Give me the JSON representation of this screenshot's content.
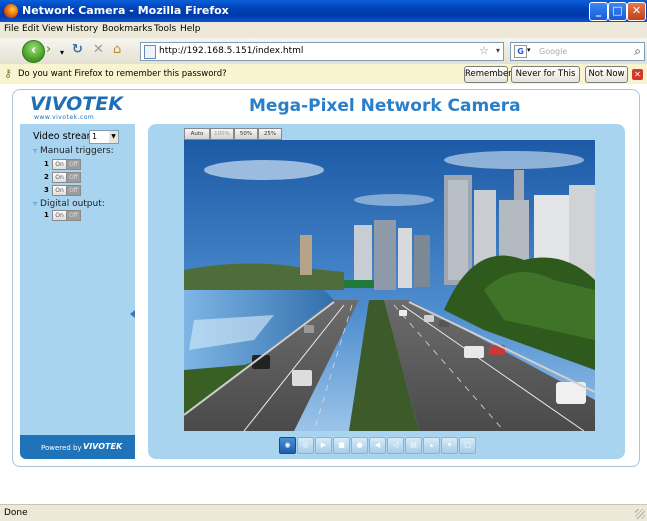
{
  "window": {
    "title": "Network Camera - Mozilla Firefox",
    "controls": [
      "_",
      "□",
      "✕"
    ]
  },
  "menu": [
    "File",
    "Edit",
    "View",
    "History",
    "Bookmarks",
    "Tools",
    "Help"
  ],
  "toolbar": {
    "url": "http://192.168.5.151/index.html",
    "search_placeholder": "Google"
  },
  "notification": {
    "message": "Do you want Firefox to remember this password?",
    "remember": "Remember",
    "never": "Never for This Site",
    "not_now": "Not Now"
  },
  "page": {
    "logo": "VIVOTEK",
    "logo_url": "www.vivotek.com",
    "title": "Mega-Pixel Network Camera",
    "video_stream_label": "Video stream:",
    "video_stream_value": "1",
    "manual_triggers_label": "Manual triggers:",
    "manual_triggers": [
      "1",
      "2",
      "3"
    ],
    "digital_output_label": "Digital output:",
    "digital_outputs": [
      "1"
    ],
    "on_label": "On",
    "off_label": "Off",
    "view_buttons": [
      "Auto",
      "100%",
      "50%",
      "25%"
    ],
    "powered_by": "Powered by",
    "powered_logo": "VIVOTEK"
  },
  "status": {
    "text": "Done"
  },
  "colors": {
    "accent": "#2a7fc9",
    "panel": "#a8d4ef",
    "brand": "#1d6fb8"
  }
}
